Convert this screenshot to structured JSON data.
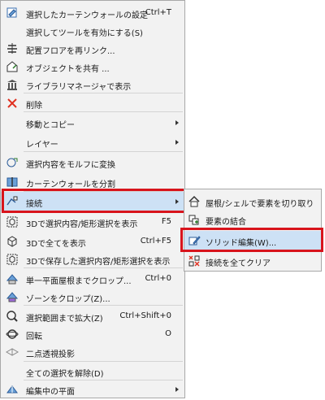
{
  "menu": {
    "items": [
      {
        "label": "選択したカーテンウォールの設定",
        "shortcut": "Ctrl+T",
        "icon": "curtain-wall-settings-icon"
      },
      {
        "label": "選択してツールを有効にする(S)",
        "shortcut": ""
      },
      {
        "label": "配置フロアを再リンク...",
        "shortcut": "",
        "icon": "relink-floor-icon"
      },
      {
        "label": "オブジェクトを共有 ...",
        "shortcut": "",
        "icon": "share-object-icon"
      },
      {
        "label": "ライブラリマネージャで表示",
        "shortcut": "",
        "icon": "library-manager-icon"
      },
      {
        "label": "削除",
        "shortcut": "",
        "icon": "delete-icon"
      },
      {
        "label": "移動とコピー",
        "shortcut": ""
      },
      {
        "label": "レイヤー",
        "shortcut": ""
      },
      {
        "label": "選択内容をモルフに変換",
        "shortcut": "",
        "icon": "convert-to-morph-icon"
      },
      {
        "label": "カーテンウォールを分割",
        "shortcut": "",
        "icon": "split-curtain-wall-icon"
      },
      {
        "label": "接続",
        "shortcut": "",
        "icon": "connect-icon"
      },
      {
        "label": "3Dで選択内容/矩形選択を表示",
        "shortcut": "F5",
        "icon": "show-selection-3d-icon"
      },
      {
        "label": "3Dで全てを表示",
        "shortcut": "Ctrl+F5",
        "icon": "show-all-3d-icon"
      },
      {
        "label": "3Dで保存した選択内容/矩形選択を表示",
        "shortcut": "",
        "icon": "show-saved-selection-3d-icon"
      },
      {
        "label": "単一平面屋根までクロップ...",
        "shortcut": "Ctrl+0",
        "icon": "crop-to-roof-icon"
      },
      {
        "label": "ゾーンをクロップ(Z)...",
        "shortcut": "",
        "icon": "crop-zones-icon"
      },
      {
        "label": "選択範囲まで拡大(Z)",
        "shortcut": "Ctrl+Shift+0",
        "icon": "zoom-to-selection-icon"
      },
      {
        "label": "回転",
        "shortcut": "O",
        "icon": "orbit-icon"
      },
      {
        "label": "二点透視投影",
        "shortcut": "",
        "icon": "two-point-perspective-icon"
      },
      {
        "label": "全ての選択を解除(D)",
        "shortcut": ""
      },
      {
        "label": "編集中の平面",
        "shortcut": "",
        "icon": "editing-plane-icon"
      }
    ]
  },
  "submenu": {
    "items": [
      {
        "label": "屋根/シェルで要素を切り取り",
        "icon": "trim-to-roof-icon"
      },
      {
        "label": "要素の結合",
        "icon": "merge-elements-icon"
      },
      {
        "label": "ソリッド編集(W)...",
        "icon": "solid-edit-icon"
      },
      {
        "label": "接続を全てクリア",
        "icon": "clear-connections-icon"
      }
    ]
  },
  "colors": {
    "highlight_border": "#d8141c",
    "selection": "#cde1f5",
    "menu_bg": "#f2f2f2"
  }
}
